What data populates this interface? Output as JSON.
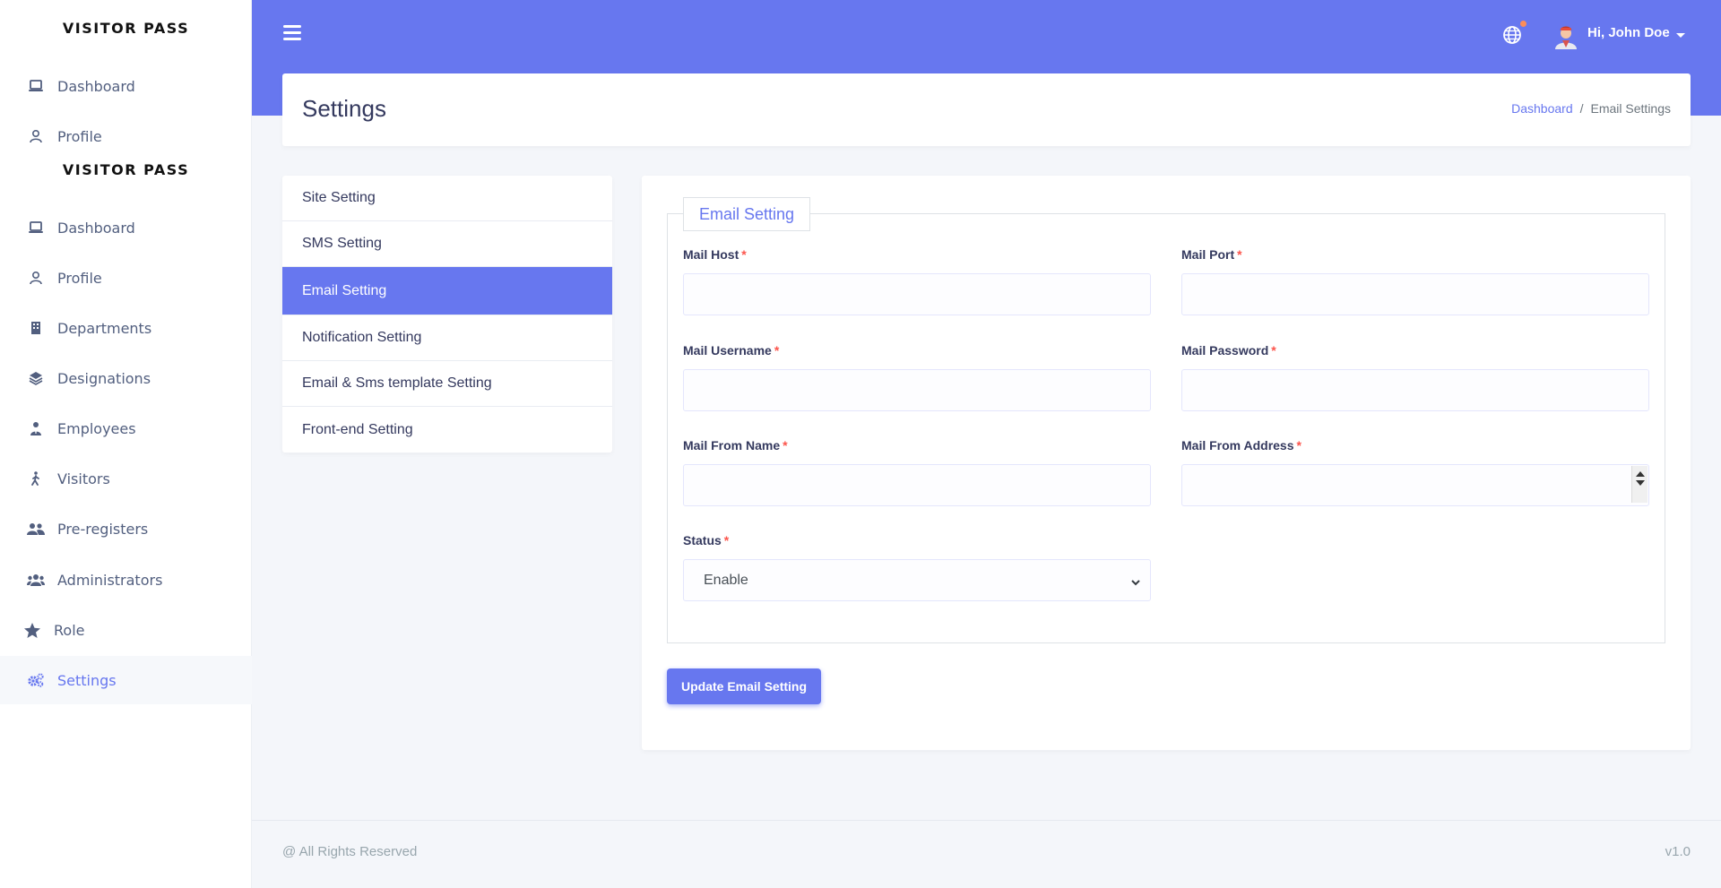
{
  "sidebar": {
    "brand_top": "VISITOR PASS",
    "brand_mid": "VISITOR PASS",
    "top_items": [
      {
        "label": "Dashboard",
        "icon": "laptop-icon"
      },
      {
        "label": "Profile",
        "icon": "user-icon"
      }
    ],
    "items": [
      {
        "label": "Dashboard",
        "icon": "laptop-icon"
      },
      {
        "label": "Profile",
        "icon": "user-icon"
      },
      {
        "label": "Departments",
        "icon": "building-icon"
      },
      {
        "label": "Designations",
        "icon": "layers-icon"
      },
      {
        "label": "Employees",
        "icon": "user-tie-icon"
      },
      {
        "label": "Visitors",
        "icon": "walking-icon"
      },
      {
        "label": "Pre-registers",
        "icon": "user-friends-icon"
      },
      {
        "label": "Administrators",
        "icon": "users-icon"
      },
      {
        "label": "Role",
        "icon": "star-icon"
      },
      {
        "label": "Settings",
        "icon": "cogs-icon"
      }
    ]
  },
  "header": {
    "user_greeting": "Hi, John Doe",
    "accent": "#6777ef"
  },
  "page": {
    "title": "Settings",
    "breadcrumb": {
      "home": "Dashboard",
      "separator": "/",
      "current": "Email Settings"
    }
  },
  "settings_menu": [
    "Site Setting",
    "SMS Setting",
    "Email Setting",
    "Notification Setting",
    "Email & Sms template Setting",
    "Front-end Setting"
  ],
  "form": {
    "legend": "Email Setting",
    "required_mark": "*",
    "mail_host": {
      "label": "Mail Host",
      "value": ""
    },
    "mail_port": {
      "label": "Mail Port",
      "value": ""
    },
    "mail_username": {
      "label": "Mail Username",
      "value": ""
    },
    "mail_password": {
      "label": "Mail Password",
      "value": ""
    },
    "mail_from_name": {
      "label": "Mail From Name",
      "value": ""
    },
    "mail_from_address": {
      "label": "Mail From Address",
      "value": ""
    },
    "status": {
      "label": "Status",
      "selected": "Enable"
    },
    "submit_label": "Update Email Setting"
  },
  "footer": {
    "left": "@ All Rights Reserved",
    "right": "v1.0"
  }
}
